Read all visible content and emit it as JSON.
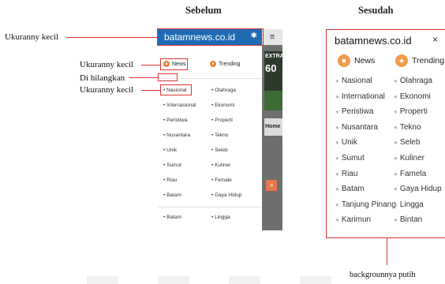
{
  "headings": {
    "before": "Sebelum",
    "after": "Sesudah"
  },
  "annotations": {
    "site_title_small": "Ukuranny kecil",
    "tabs_small": "Ukuranny kecil",
    "removed": "Di hilangkan",
    "item_small": "Ukuranny kecil",
    "white_background": "backgrounnya putih"
  },
  "before": {
    "site_title": "batamnews.co.id",
    "menu_icon": "≡",
    "tabs": {
      "news": "News",
      "trending": "Trending"
    },
    "left_items": [
      "Nasional",
      "Internasional",
      "Peristiwa",
      "Nusantara",
      "Unik",
      "Sumut",
      "Riau",
      "Batam"
    ],
    "right_items": [
      "Olahraga",
      "Ekonomi",
      "Properti",
      "Tekno",
      "Seleb",
      "Kuliner",
      "Female",
      "Gaya Hidup"
    ],
    "extra_left": "Batam",
    "extra_right": "Lingga",
    "thumb_text_1": "EXTRA",
    "thumb_text_2": "60",
    "home_label": "Home",
    "up_arrow": "»"
  },
  "after": {
    "site_title": "batamnews.co.id",
    "close_symbol": "×",
    "tabs": {
      "news": "News",
      "trending": "Trending"
    },
    "left_items": [
      "Nasional",
      "International",
      "Peristiwa",
      "Nusantara",
      "Unik",
      "Sumut",
      "Riau",
      "Batam",
      "Tanjung Pinang",
      "Karimun"
    ],
    "right_items": [
      "Olahraga",
      "Ekonomi",
      "Properti",
      "Tekno",
      "Seleb",
      "Kuliner",
      "Famela",
      "Gaya Hidup",
      "Lingga",
      "Bintan"
    ]
  },
  "colors": {
    "annotation": "#dd3333",
    "header_blue": "#1e6bb3",
    "accent_orange": "#f29b4b"
  }
}
